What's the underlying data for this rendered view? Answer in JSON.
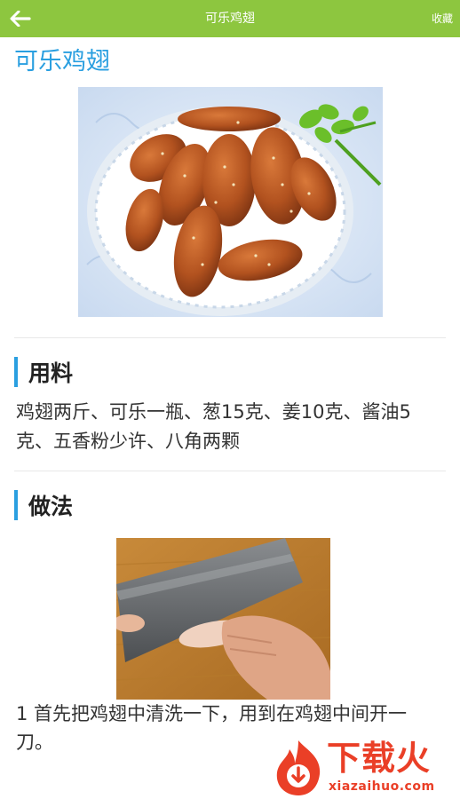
{
  "topbar": {
    "title": "可乐鸡翅",
    "favorite_label": "收藏",
    "back_icon": "arrow-left-icon",
    "bg_color": "#8dc63f"
  },
  "recipe": {
    "title": "可乐鸡翅",
    "accent_color": "#2a9fe0"
  },
  "ingredients": {
    "heading": "用料",
    "text": "鸡翅两斤、可乐一瓶、葱15克、姜10克、酱油5克、五香粉少许、八角两颗"
  },
  "method": {
    "heading": "做法",
    "steps": [
      {
        "text": "1 首先把鸡翅中清洗一下，用到在鸡翅中间开一刀。"
      }
    ]
  },
  "watermark": {
    "brand": "下载火",
    "url": "xiazaihuo.com"
  }
}
